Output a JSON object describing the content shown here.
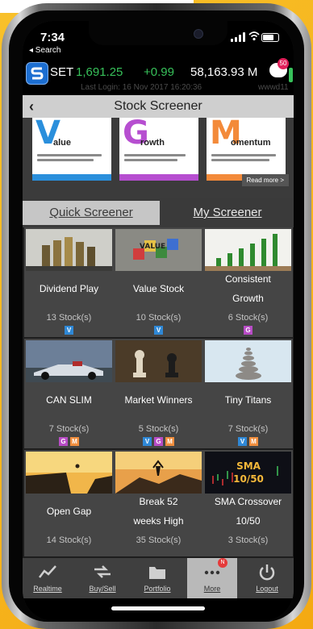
{
  "status_bar": {
    "time": "7:34",
    "back_label": "◂ Search"
  },
  "ticker": {
    "index_name": "SET",
    "index_value": "1,691.25",
    "change": "+0.99",
    "volume": "58,163.93 M",
    "last_login": "Last Login: 16 Nov 2017 16:20:36",
    "user": "wwwd11",
    "notification_count": "50"
  },
  "header": {
    "title": "Stock Screener"
  },
  "banner": {
    "items": [
      {
        "letter": "V",
        "word": "alue",
        "color": "#2a8fdc"
      },
      {
        "letter": "G",
        "word": "rowth",
        "color": "#b64ed0"
      },
      {
        "letter": "M",
        "word": "omentum",
        "color": "#f38a3a"
      }
    ],
    "read_more": "Read more >"
  },
  "tabs": [
    {
      "label": "Quick Screener",
      "active": true
    },
    {
      "label": "My Screener",
      "active": false
    }
  ],
  "screeners": [
    {
      "name_lines": [
        "Dividend Play"
      ],
      "count": "13 Stock(s)",
      "tags": [
        "V"
      ],
      "image": "coins"
    },
    {
      "name_lines": [
        "Value Stock"
      ],
      "count": "10 Stock(s)",
      "tags": [
        "V"
      ],
      "image": "value-blocks"
    },
    {
      "name_lines": [
        "Consistent",
        "Growth"
      ],
      "count": "6 Stock(s)",
      "tags": [
        "G"
      ],
      "image": "plants"
    },
    {
      "name_lines": [
        "CAN SLIM"
      ],
      "count": "7 Stock(s)",
      "tags": [
        "G",
        "M"
      ],
      "image": "race-car"
    },
    {
      "name_lines": [
        "Market Winners"
      ],
      "count": "5 Stock(s)",
      "tags": [
        "V",
        "G",
        "M"
      ],
      "image": "chess"
    },
    {
      "name_lines": [
        "Tiny Titans"
      ],
      "count": "7 Stock(s)",
      "tags": [
        "V",
        "M"
      ],
      "image": "stones"
    },
    {
      "name_lines": [
        "Open Gap"
      ],
      "count": "14 Stock(s)",
      "tags": [],
      "image": "cliff-jump"
    },
    {
      "name_lines": [
        "Break 52",
        "weeks High"
      ],
      "count": "35 Stock(s)",
      "tags": [],
      "image": "mountain-top"
    },
    {
      "name_lines": [
        "SMA Crossover",
        "10/50"
      ],
      "count": "3 Stock(s)",
      "tags": [],
      "image": "sma-chart",
      "image_text": [
        "SMA",
        "10/50"
      ]
    }
  ],
  "nav": [
    {
      "label": "Realtime",
      "icon": "chart-line-icon"
    },
    {
      "label": "Buy/Sell",
      "icon": "arrows-swap-icon"
    },
    {
      "label": "Portfolio",
      "icon": "folder-icon"
    },
    {
      "label": "More",
      "icon": "more-dots-icon",
      "active": true,
      "badge": "N"
    },
    {
      "label": "Logout",
      "icon": "power-icon"
    }
  ]
}
